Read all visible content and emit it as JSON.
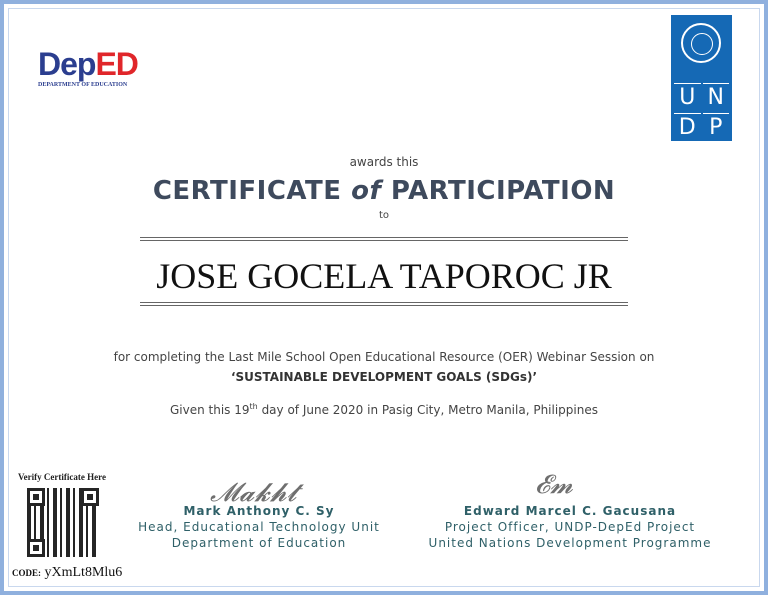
{
  "logos": {
    "deped_word_1": "Dep",
    "deped_word_2": "ED",
    "deped_sub": "DEPARTMENT OF EDUCATION",
    "undp_letters": [
      "U",
      "N",
      "D",
      "P"
    ]
  },
  "certificate": {
    "awards": "awards this",
    "title_1": "CERTIFICATE ",
    "title_of": "of",
    "title_2": " PARTICIPATION",
    "to": "to",
    "recipient": "JOSE GOCELA TAPOROC JR",
    "for_text": "for completing the Last Mile School Open Educational Resource (OER) Webinar Session on",
    "topic": "‘SUSTAINABLE DEVELOPMENT GOALS (SDGs)’",
    "given_1": "Given this 19",
    "given_sup": "th",
    "given_2": " day of June 2020 in Pasig City, Metro Manila, Philippines"
  },
  "verify": {
    "label": "Verify Certificate Here",
    "code_label": "CODE:",
    "code": "yXmLt8Mlu6"
  },
  "signatories": [
    {
      "name": "Mark Anthony C. Sy",
      "title": "Head, Educational Technology Unit",
      "org": "Department of Education"
    },
    {
      "name": "Edward Marcel C. Gacusana",
      "title": "Project Officer, UNDP-DepEd Project",
      "org": "United Nations Development Programme"
    }
  ]
}
